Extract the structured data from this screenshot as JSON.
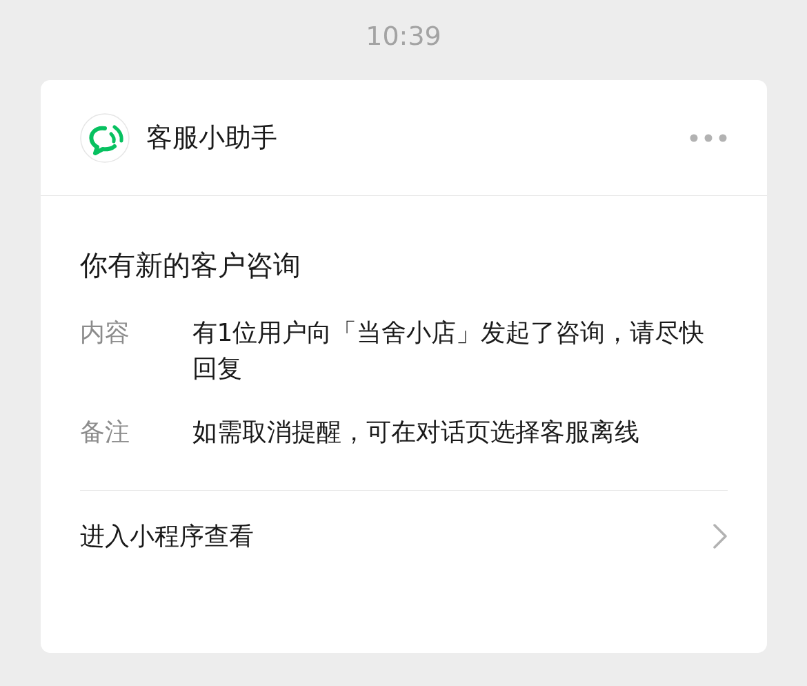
{
  "time": "10:39",
  "card": {
    "sender": "客服小助手",
    "title": "你有新的客户咨询",
    "fields": [
      {
        "label": "内容",
        "value": "有1位用户向「当舍小店」发起了咨询，请尽快回复"
      },
      {
        "label": "备注",
        "value": "如需取消提醒，可在对话页选择客服离线"
      }
    ],
    "action": "进入小程序查看"
  }
}
